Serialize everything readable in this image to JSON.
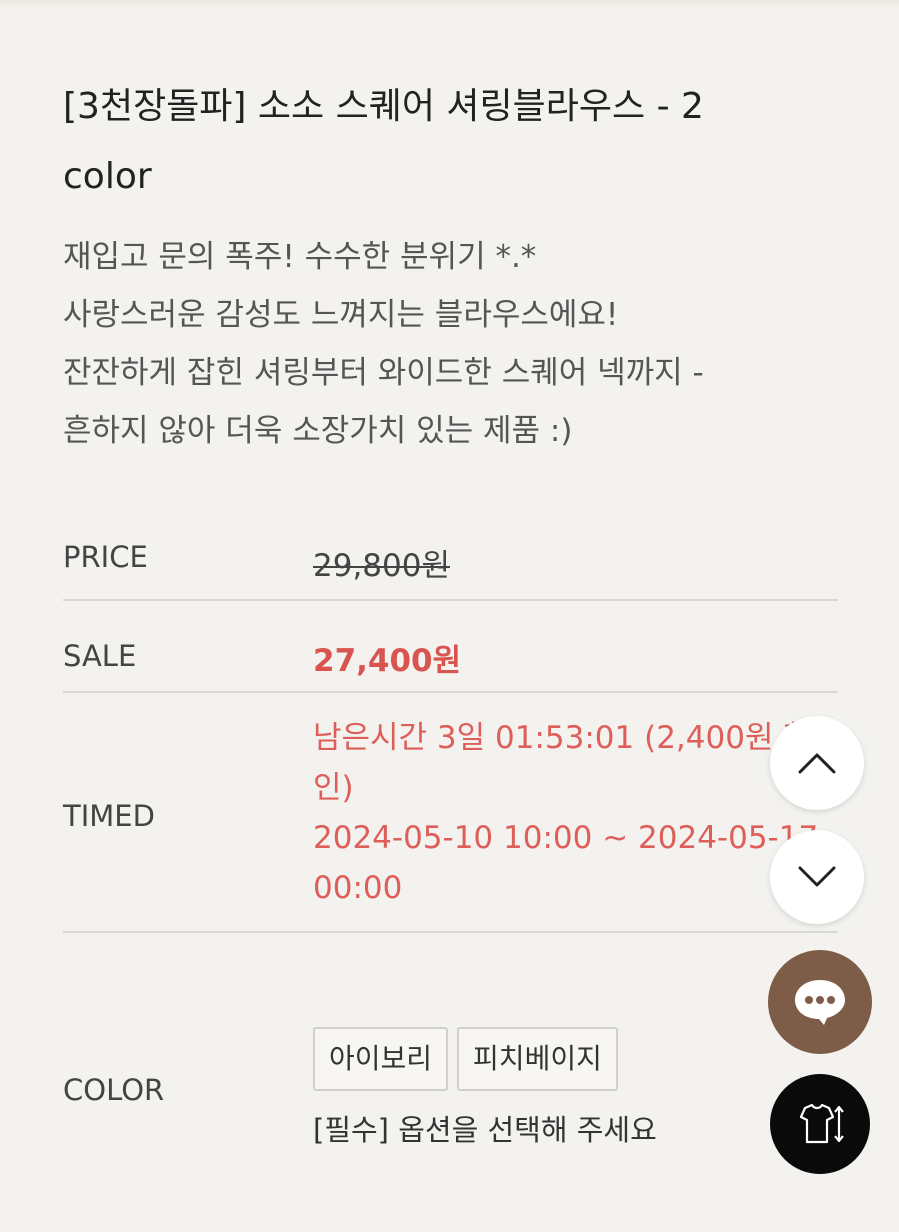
{
  "product": {
    "title": "[3천장돌파] 소소 스퀘어 셔링블라우스 - 2 color",
    "description": [
      "재입고 문의 폭주! 수수한 분위기 *.*",
      "사랑스러운 감성도 느껴지는 블라우스에요!",
      "잔잔하게 잡힌 셔링부터 와이드한 스퀘어 넥까지 -",
      "흔하지 않아 더욱 소장가치 있는 제품 :)"
    ]
  },
  "info": {
    "price_label": "PRICE",
    "price_value": "29,800원",
    "sale_label": "SALE",
    "sale_value": "27,400원",
    "timed_label": "TIMED",
    "timed_line1": "남은시간 3일 01:53:01 (2,400원 할인)",
    "timed_line2": "2024-05-10 10:00 ~ 2024-05-17 00:00",
    "color_label": "COLOR",
    "color_options": [
      "아이보리",
      "피치베이지"
    ],
    "color_notice": "[필수] 옵션을 선택해 주세요"
  },
  "icons": {
    "scroll_up": "chevron-up-icon",
    "scroll_down": "chevron-down-icon",
    "chat": "chat-bubble-icon",
    "size": "shirt-size-icon"
  },
  "colors": {
    "sale_red": "#d9534f",
    "chat_brown": "#7d5c48",
    "background": "#f3f2ef"
  }
}
